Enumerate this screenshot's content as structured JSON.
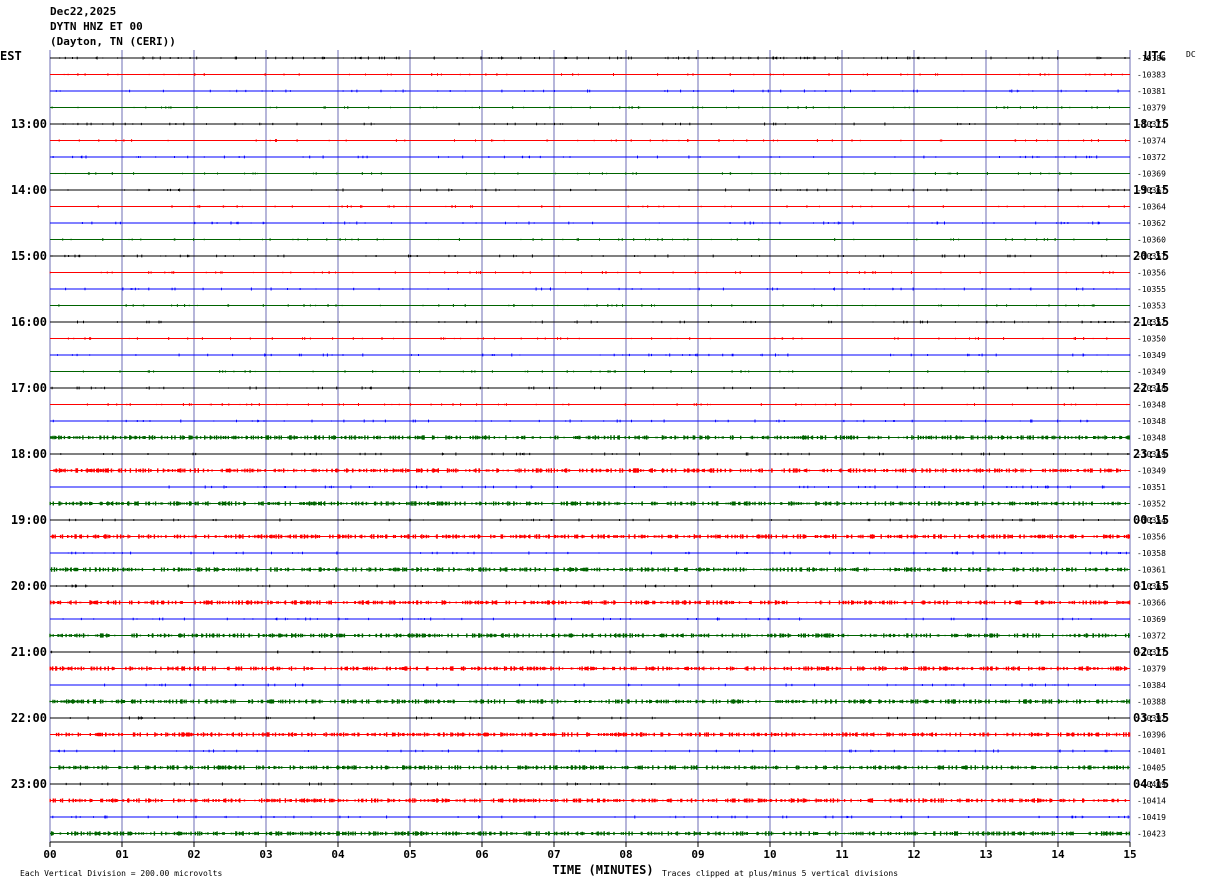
{
  "header": {
    "date": "Dec22,2025",
    "station": "DYTN HNZ ET 00",
    "location": "(Dayton, TN (CERI))"
  },
  "labels": {
    "left_tz": "EST",
    "right_tz": "UTC",
    "dc": "DC",
    "xlabel": "TIME (MINUTES)",
    "scale_note": "Each Vertical Division =  200.00 microvolts",
    "clip_note": "Traces clipped at plus/minus 5 vertical divisions"
  },
  "chart_data": {
    "type": "line",
    "title": "DYTN HNZ ET 00",
    "xlabel": "TIME (MINUTES)",
    "xlim": [
      0,
      15
    ],
    "x_ticks": [
      "00",
      "01",
      "02",
      "03",
      "04",
      "05",
      "06",
      "07",
      "08",
      "09",
      "10",
      "11",
      "12",
      "13",
      "14",
      "15"
    ],
    "left_hour_labels": [
      "13:00",
      "14:00",
      "15:00",
      "16:00",
      "17:00",
      "18:00",
      "19:00",
      "20:00",
      "21:00",
      "22:00",
      "23:00"
    ],
    "right_hour_labels": [
      "18:15",
      "19:15",
      "20:15",
      "21:15",
      "22:15",
      "23:15",
      "00:15",
      "01:15",
      "02:15",
      "03:15",
      "04:15"
    ],
    "trace_colors": [
      "#000000",
      "#ff0000",
      "#0000ff",
      "#006400"
    ],
    "grid_colors": {
      "vertical": "#6e6eb4",
      "horizontal_black": "#000000"
    },
    "dc_offsets": [
      -10386,
      -10383,
      -10381,
      -10379,
      -10377,
      -10374,
      -10372,
      -10369,
      -10367,
      -10364,
      -10362,
      -10360,
      -10357,
      -10356,
      -10355,
      -10353,
      -10352,
      -10350,
      -10349,
      -10349,
      -10348,
      -10348,
      -10348,
      -10348,
      -10349,
      -10349,
      -10351,
      -10352,
      -10354,
      -10356,
      -10358,
      -10361,
      -10363,
      -10366,
      -10369,
      -10372,
      -10377,
      -10379,
      -10384,
      -10388,
      -10392,
      -10396,
      -10401,
      -10405,
      -10409,
      -10414,
      -10419,
      -10423
    ],
    "trace_activity": [
      2,
      1,
      1,
      1,
      1,
      1,
      1,
      1,
      1,
      1,
      1,
      1,
      1,
      1,
      1,
      1,
      1,
      1,
      1,
      1,
      1,
      1,
      1,
      3,
      1,
      3,
      1,
      3,
      1,
      3,
      1,
      3,
      1,
      3,
      1,
      3,
      1,
      3,
      1,
      3,
      1,
      3,
      1,
      3,
      1,
      3,
      1,
      3
    ],
    "scale_microvolts_per_division": 200.0,
    "clip_divisions": 5
  }
}
